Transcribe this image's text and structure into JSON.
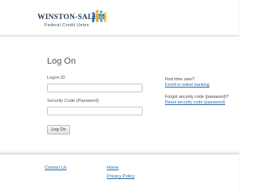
{
  "brand": {
    "name_line1": "WINSTON-SALEM",
    "name_line2": "Federal Credit Union",
    "logo_colors": [
      "#2e6fb0",
      "#e2a72b",
      "#5aa6d6",
      "#f0c247"
    ]
  },
  "login": {
    "title": "Log On",
    "login_id_label": "Logon ID",
    "login_id_value": "",
    "security_code_label": "Security Code (Password)",
    "security_code_value": "",
    "submit_label": "Log On"
  },
  "sidebar": {
    "first_time_label": "First time user?",
    "enroll_link": "Enroll in online banking",
    "forgot_label": "Forgot security code (password)?",
    "reset_link": "Reset security code (password)"
  },
  "footer": {
    "contact_link": "Contact Us",
    "home_link": "Home",
    "privacy_link": "Privacy Policy"
  },
  "colors": {
    "link": "#2a6aa8",
    "text": "#555555",
    "brand_navy": "#2a3f56"
  }
}
